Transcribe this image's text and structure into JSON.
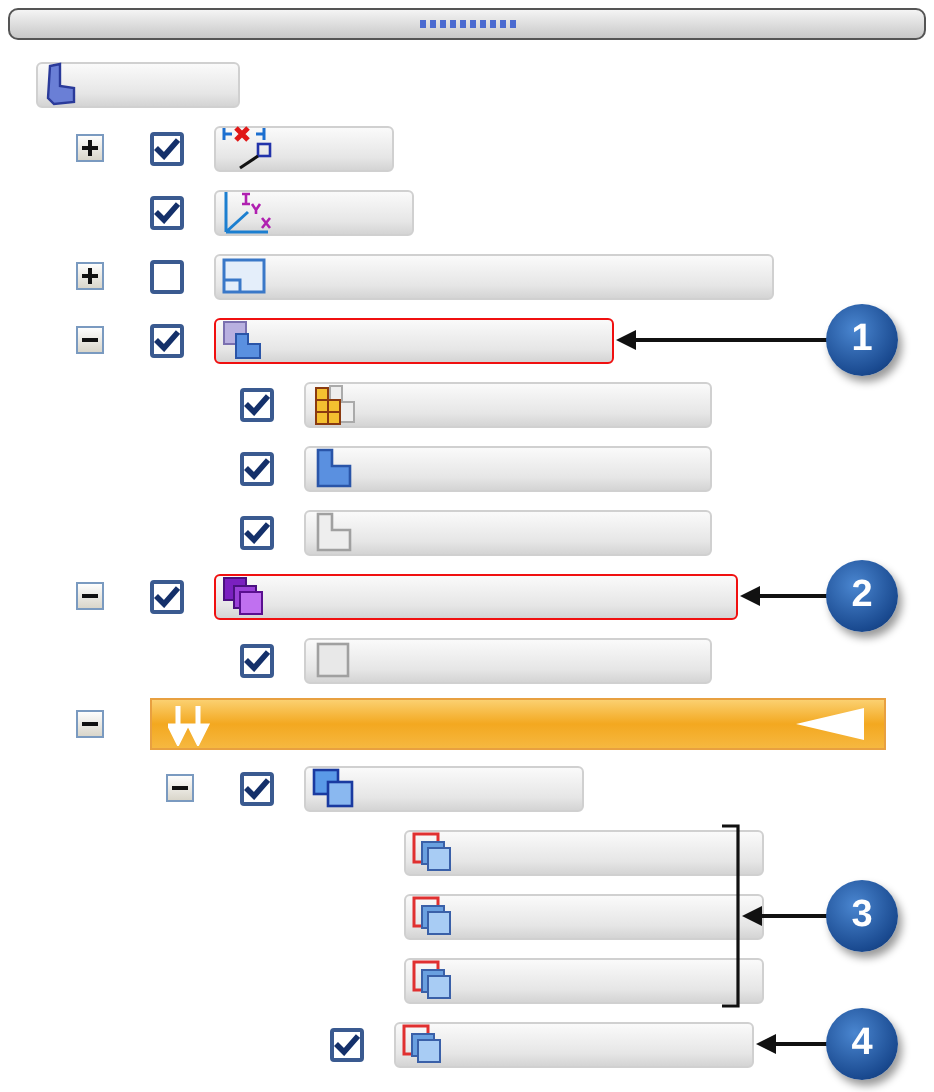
{
  "splitter": {
    "kind": "handle"
  },
  "tree": [
    {
      "kind": "part",
      "children": [
        {
          "kind": "constraint",
          "expanded": false,
          "checked": true
        },
        {
          "kind": "axes",
          "checked": true
        },
        {
          "kind": "sketch",
          "expanded": false,
          "checked": false
        },
        {
          "kind": "step_blue",
          "expanded": true,
          "checked": true,
          "highlighted": true,
          "callout": "1",
          "children": [
            {
              "kind": "grid_orange",
              "checked": true
            },
            {
              "kind": "step_solid",
              "checked": true
            },
            {
              "kind": "step_gray",
              "checked": true
            }
          ]
        },
        {
          "kind": "stack_purple",
          "expanded": true,
          "checked": true,
          "highlighted": true,
          "callout": "2",
          "children": [
            {
              "kind": "square_gray",
              "checked": true
            }
          ]
        },
        {
          "kind": "rollback_bar",
          "expanded": true,
          "children": [
            {
              "kind": "stack_blue",
              "expanded": true,
              "checked": true,
              "children": [
                {
                  "kind": "stack_red",
                  "bracketed": true,
                  "callout": "3"
                },
                {
                  "kind": "stack_red",
                  "bracketed": true
                },
                {
                  "kind": "stack_red",
                  "bracketed": true
                },
                {
                  "kind": "stack_red",
                  "checked": true,
                  "callout": "4"
                }
              ]
            }
          ]
        }
      ]
    }
  ]
}
